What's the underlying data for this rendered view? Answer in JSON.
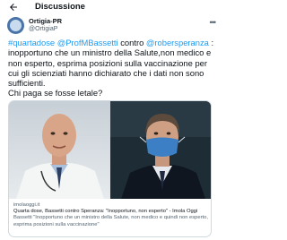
{
  "header": {
    "back_icon": "arrow-left-icon",
    "title": "Discussione"
  },
  "tweet": {
    "author": {
      "name": "Ortigia-PR",
      "handle": "@OrtigiaP"
    },
    "more_icon": "more-dots-icon",
    "segments": [
      {
        "text": "#quartadose",
        "type": "hashtag"
      },
      {
        "text": " ",
        "type": "plain"
      },
      {
        "text": "@ProfMBassetti",
        "type": "mention"
      },
      {
        "text": " contro ",
        "type": "plain"
      },
      {
        "text": "@robersperanza",
        "type": "mention"
      },
      {
        "text": " : inopportuno che un ministro della Salute,non medico e non esperto, esprima posizioni sulla vaccinazione per cui gli scienziati hanno dichiarato che i dati non sono sufficienti.",
        "type": "plain"
      }
    ],
    "question": "Chi paga se fosse letale?",
    "card": {
      "domain": "imolaoggi.it",
      "title": "Quarta dose, Bassetti contro Speranza: \"Inopportuno, non esperto\" - Imola Oggi",
      "description": "Bassetti \"Inopportuno che un ministro della Salute, non medico e quindi non esperto, esprima posizioni sulla vaccinazione\""
    }
  },
  "colors": {
    "link": "#1d9bf0",
    "text": "#0f1419",
    "secondary": "#536471",
    "border": "#cfd9de"
  }
}
